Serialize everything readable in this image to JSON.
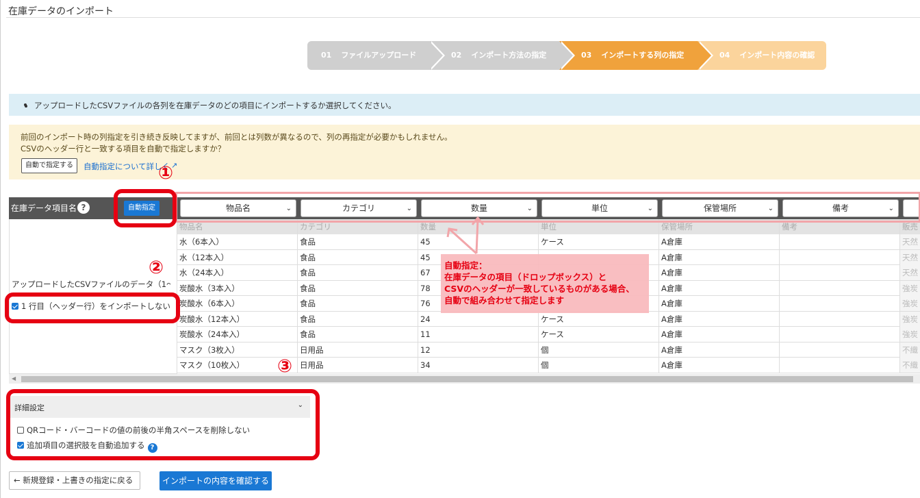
{
  "window_title": "在庫データのインポート",
  "steps": [
    {
      "num": "01",
      "label": "ファイルアップロード",
      "state": "done"
    },
    {
      "num": "02",
      "label": "インポート方法の指定",
      "state": "done"
    },
    {
      "num": "03",
      "label": "インポートする列の指定",
      "state": "current"
    },
    {
      "num": "04",
      "label": "インポート内容の確認",
      "state": "upcoming"
    }
  ],
  "info": {
    "text": "アップロードしたCSVファイルの各列を在庫データのどの項目にインポートするか選択してください。"
  },
  "warning": {
    "line1": "前回のインポート時の列指定を引き続き反映してますが、前回とは列数が異なるので、列の再指定が必要かもしれません。",
    "line2": "CSVのヘッダー行と一致する項目を自動で指定しますか？",
    "auto_button": "自動で指定する",
    "link": "自動指定について詳しく"
  },
  "left_panel": {
    "header": "在庫データ項目名",
    "auto_button": "自動指定",
    "upload_label": "アップロードしたCSVファイルのデータ（1〜",
    "skip_header_checkbox": "1 行目（ヘッダー行）をインポートしない"
  },
  "columns": [
    "物品名",
    "カテゴリ",
    "数量",
    "単位",
    "保管場所",
    "備考"
  ],
  "csv_headers": [
    "物品名",
    "カテゴリ",
    "数量",
    "単位",
    "保管場所",
    "備考",
    "販売"
  ],
  "rows": [
    [
      "水（6本入）",
      "食品",
      "45",
      "ケース",
      "A倉庫",
      "",
      "天然"
    ],
    [
      "水（12本入）",
      "食品",
      "45",
      "",
      "A倉庫",
      "",
      "天然"
    ],
    [
      "水（24本入）",
      "食品",
      "67",
      "",
      "A倉庫",
      "",
      "天然"
    ],
    [
      "炭酸水（3本入）",
      "食品",
      "78",
      "",
      "A倉庫",
      "",
      "強炭"
    ],
    [
      "炭酸水（6本入）",
      "食品",
      "76",
      "",
      "A倉庫",
      "",
      "強炭"
    ],
    [
      "炭酸水（12本入）",
      "食品",
      "24",
      "ケース",
      "A倉庫",
      "",
      "強炭"
    ],
    [
      "炭酸水（24本入）",
      "食品",
      "11",
      "ケース",
      "A倉庫",
      "",
      "強炭"
    ],
    [
      "マスク（3枚入）",
      "日用品",
      "12",
      "個",
      "A倉庫",
      "",
      "不織"
    ],
    [
      "マスク（10枚入）",
      "日用品",
      "34",
      "個",
      "A倉庫",
      "",
      "不織"
    ]
  ],
  "details": {
    "title": "詳細設定",
    "option1": "QRコード・バーコードの値の前後の半角スペースを削除しない",
    "option2": "追加項目の選択肢を自動追加する"
  },
  "buttons": {
    "back": "新規登録・上書きの指定に戻る",
    "confirm": "インポートの内容を確認する"
  },
  "annotations": {
    "n1": "①",
    "n2": "②",
    "n3": "③",
    "callout_line1": "自動指定：",
    "callout_line2": "在庫データの項目（ドロップボックス）と",
    "callout_line3": "CSVのヘッダーが一致しているものがある場合、",
    "callout_line4": "自動で組み合わせて指定します"
  },
  "colors": {
    "accent": "#1a78d4",
    "step_current": "#f0a23c",
    "annotation_red": "#e60012"
  }
}
